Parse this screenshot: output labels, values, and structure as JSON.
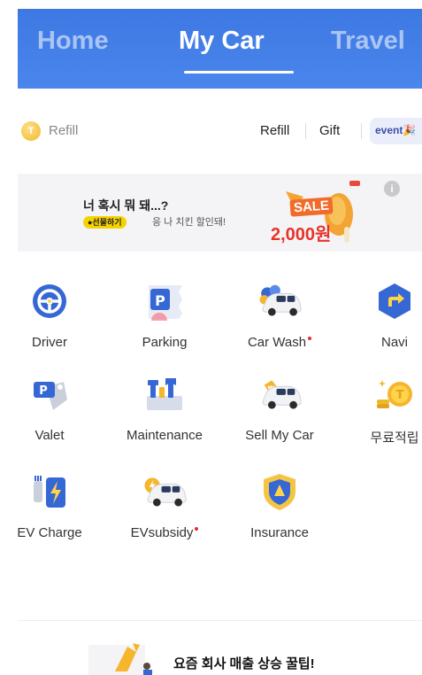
{
  "header": {
    "tabs": [
      {
        "label": "Home",
        "active": false
      },
      {
        "label": "My Car",
        "active": true
      },
      {
        "label": "Travel",
        "active": false
      }
    ],
    "accent": "#4a86ec"
  },
  "refill_row": {
    "left_label": "Refill",
    "links": [
      "Refill",
      "Gift"
    ],
    "event_label": "event"
  },
  "banner": {
    "title": "너 혹시 뭐 돼...?",
    "pill": "●선물하기",
    "subtitle": "응 나 치킨 할인돼!",
    "sale_label": "SALE",
    "sale_price": "2,000원",
    "info_icon": "info-icon"
  },
  "services": [
    {
      "label": "Driver",
      "icon": "steering-wheel-icon",
      "dot": false
    },
    {
      "label": "Parking",
      "icon": "parking-ticket-icon",
      "dot": false
    },
    {
      "label": "Car Wash",
      "icon": "car-wash-icon",
      "dot": true
    },
    {
      "label": "Navi",
      "icon": "navigation-icon",
      "dot": false
    },
    {
      "label": "Valet",
      "icon": "valet-tag-icon",
      "dot": false
    },
    {
      "label": "Maintenance",
      "icon": "toolbox-icon",
      "dot": false
    },
    {
      "label": "Sell My Car",
      "icon": "car-sell-icon",
      "dot": false
    },
    {
      "label": "무료적립",
      "icon": "coin-stack-icon",
      "dot": false
    },
    {
      "label": "EV Charge",
      "icon": "ev-charger-icon",
      "dot": false
    },
    {
      "label": "EVsubsidy",
      "icon": "ev-subsidy-car-icon",
      "dot": true
    },
    {
      "label": "Insurance",
      "icon": "shield-icon",
      "dot": false
    }
  ],
  "bottom": {
    "text": "요즘 회사 매출 상승 꿀팁!"
  }
}
